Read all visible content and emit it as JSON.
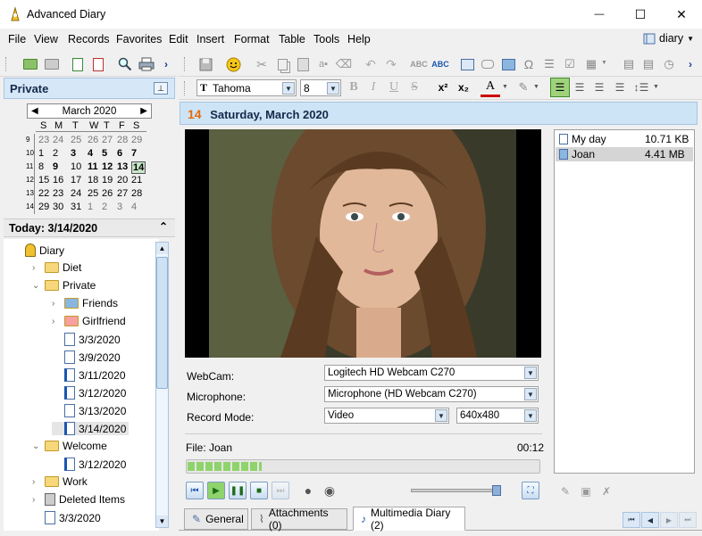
{
  "window": {
    "title": "Advanced Diary",
    "minimize": "—",
    "maximize": "☐",
    "close": "✕"
  },
  "menu": [
    "File",
    "View",
    "Records",
    "Favorites",
    "Edit",
    "Insert",
    "Format",
    "Table",
    "Tools",
    "Help"
  ],
  "user_menu": {
    "label": "diary"
  },
  "left_panel": {
    "title": "Private"
  },
  "calendar": {
    "month": "March 2020",
    "weekday_headers": [
      "S",
      "M",
      "T",
      "W",
      "T",
      "F",
      "S"
    ],
    "weeks": [
      {
        "num": "9",
        "days": [
          "23",
          "24",
          "25",
          "26",
          "27",
          "28",
          "29"
        ]
      },
      {
        "num": "10",
        "days": [
          "1",
          "2",
          "3",
          "4",
          "5",
          "6",
          "7"
        ]
      },
      {
        "num": "11",
        "days": [
          "8",
          "9",
          "10",
          "11",
          "12",
          "13",
          "14"
        ]
      },
      {
        "num": "12",
        "days": [
          "15",
          "16",
          "17",
          "18",
          "19",
          "20",
          "21"
        ]
      },
      {
        "num": "13",
        "days": [
          "22",
          "23",
          "24",
          "25",
          "26",
          "27",
          "28"
        ]
      },
      {
        "num": "14",
        "days": [
          "29",
          "30",
          "31",
          "1",
          "2",
          "3",
          "4"
        ]
      }
    ]
  },
  "today_label": "Today: 3/14/2020",
  "tree": [
    {
      "label": "Diary",
      "icon": "diary-icon",
      "depth": 0
    },
    {
      "label": "Diet",
      "icon": "folder-icon",
      "depth": 1
    },
    {
      "label": "Private",
      "icon": "folder-open-icon",
      "depth": 1
    },
    {
      "label": "Friends",
      "icon": "friends-icon",
      "depth": 2
    },
    {
      "label": "Girlfriend",
      "icon": "heart-folder-icon",
      "depth": 2
    },
    {
      "label": "3/3/2020",
      "icon": "document-icon",
      "depth": 2
    },
    {
      "label": "3/9/2020",
      "icon": "document-icon",
      "depth": 2
    },
    {
      "label": "3/11/2020",
      "icon": "audio-document-icon",
      "depth": 2
    },
    {
      "label": "3/12/2020",
      "icon": "audio-document-icon",
      "depth": 2
    },
    {
      "label": "3/13/2020",
      "icon": "document-icon",
      "depth": 2
    },
    {
      "label": "3/14/2020",
      "icon": "audio-document-icon",
      "depth": 2
    },
    {
      "label": "Welcome",
      "icon": "folder-open-icon",
      "depth": 1
    },
    {
      "label": "3/12/2020",
      "icon": "audio-document-icon",
      "depth": 2
    },
    {
      "label": "Work",
      "icon": "work-folder-icon",
      "depth": 1
    },
    {
      "label": "Deleted Items",
      "icon": "trash-icon",
      "depth": 1
    },
    {
      "label": "3/3/2020",
      "icon": "document-icon",
      "depth": 1
    }
  ],
  "format": {
    "font": "Tahoma",
    "size": "8"
  },
  "date_header": {
    "day": "14",
    "text": "Saturday, March 2020"
  },
  "multimedia": {
    "webcam_label": "WebCam:",
    "webcam_value": "Logitech HD Webcam C270",
    "mic_label": "Microphone:",
    "mic_value": "Microphone (HD Webcam C270)",
    "mode_label": "Record Mode:",
    "mode_value": "Video",
    "resolution_value": "640x480",
    "file_label": "File: Joan",
    "time": "00:12",
    "progress": 0.21
  },
  "attachments": [
    {
      "name": "My day",
      "size": "10.71 KB",
      "icon": "audio-file-icon"
    },
    {
      "name": "Joan",
      "size": "4.41 MB",
      "icon": "video-file-icon"
    }
  ],
  "tabs": [
    {
      "label": "General",
      "icon": "page-edit-icon"
    },
    {
      "label": "Attachments (0)",
      "icon": "paperclip-icon"
    },
    {
      "label": "Multimedia Diary (2)",
      "icon": "music-note-icon"
    }
  ],
  "colors": {
    "accent_orange": "#e46c0a",
    "selection": "#cde8ff",
    "today_highlight": "#c8e6c9"
  }
}
